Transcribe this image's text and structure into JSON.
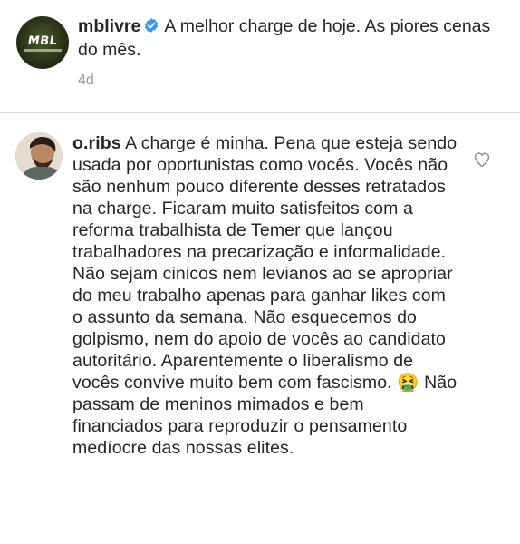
{
  "post": {
    "username": "mblivre",
    "caption": "A melhor charge de hoje. As piores cenas do mês.",
    "time": "4d",
    "avatar_icon": "mbl-logo-avatar"
  },
  "comment": {
    "username": "o.ribs",
    "text": "A charge é minha. Pena que esteja sendo usada por oportunistas como vocês. Vocês não são nenhum pouco diferente desses retratados na charge. Ficaram muito satisfeitos com a reforma trabalhista de Temer que lançou trabalhadores na precarização e informalidade. Não sejam cinicos nem levianos ao se apropriar do meu trabalho apenas para ganhar likes com o assunto da semana. Não esquecemos do golpismo, nem do apoio de vocês ao candidato autoritário. Aparentemente o liberalismo de vocês convive muito bem com fascismo.",
    "emoji": "🤮",
    "text_after_emoji": "Não passam de meninos mimados e bem financiados para reproduzir o pensamento medíocre das nossas elites.",
    "like_icon": "heart-outline-icon"
  },
  "colors": {
    "text": "#262626",
    "muted": "#999999",
    "verified_blue": "#3897f0",
    "divider": "#dbdbdb"
  }
}
